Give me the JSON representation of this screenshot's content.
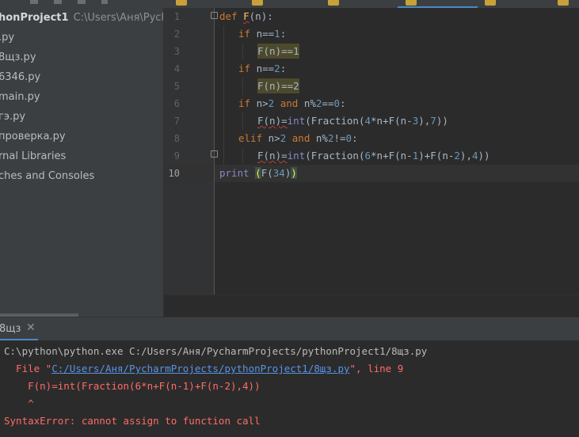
{
  "sidebar": {
    "project_name": "honProject1",
    "project_path": "C:\\Users\\Аня\\Pychar",
    "items": [
      {
        "label": ".py"
      },
      {
        "label": "8щз.py"
      },
      {
        "label": "6346.py"
      },
      {
        "label": "main.py"
      },
      {
        "label": "гэ.py"
      },
      {
        "label": "проверка.py"
      },
      {
        "label": "rnal Libraries"
      },
      {
        "label": "ches and Consoles"
      }
    ]
  },
  "editor": {
    "line_numbers": [
      "1",
      "2",
      "3",
      "4",
      "5",
      "6",
      "7",
      "8",
      "9",
      "10"
    ],
    "current_line": "10",
    "code": {
      "l1": {
        "kw": "def",
        "fn": "F",
        "rest": "(n):"
      },
      "l2": {
        "kw": "if",
        "a": "n==",
        "n": "1",
        "b": ":"
      },
      "l3": {
        "text": "F(n)==1"
      },
      "l4": {
        "kw": "if",
        "a": "n==",
        "n": "2",
        "b": ":"
      },
      "l5": {
        "text": "F(n)==2"
      },
      "l6": {
        "kw1": "if",
        "a": "n>",
        "n1": "2",
        "kw2": "and",
        "b": "n%",
        "n2": "2",
        "c": "==",
        "n3": "0",
        "d": ":"
      },
      "l7": {
        "a": "F(n)=",
        "bi": "int",
        "b": "(Fraction(",
        "n1": "4",
        "c": "*n+F(n-",
        "n2": "3",
        "d": "),",
        "n3": "7",
        "e": "))"
      },
      "l8": {
        "kw1": "elif",
        "a": "n>",
        "n1": "2",
        "kw2": "and",
        "b": "n%",
        "n2": "2",
        "c": "!=",
        "n3": "0",
        "d": ":"
      },
      "l9": {
        "a": "F(n)=",
        "bi": "int",
        "b": "(Fraction(",
        "n1": "6",
        "c": "*n+F(n-",
        "n2": "1",
        "d": ")+F(n-",
        "n3": "2",
        "e": "),",
        "n4": "4",
        "f": "))"
      },
      "l10": {
        "bi": "print",
        "sp": " ",
        "open": "(",
        "a": "F(",
        "n": "34",
        "b": ")",
        "close": ")"
      }
    }
  },
  "run": {
    "tab_label": "8щз",
    "close_glyph": "✕",
    "lines": {
      "cmd": "C:\\python\\python.exe C:/Users/Аня/PycharmProjects/pythonProject1/8щз.py",
      "file_prefix": "  File \"",
      "file_link": "C:/Users/Аня/PycharmProjects/pythonProject1/8щз.py",
      "file_suffix": "\", line 9",
      "code_line": "    F(n)=int(Fraction(6*n+F(n-1)+F(n-2),4))",
      "caret": "    ^",
      "error": "SyntaxError: cannot assign to function call"
    }
  },
  "colors": {
    "keyword": "#cc7832",
    "function": "#ffc66d",
    "number": "#6897bb",
    "builtin": "#8888c6",
    "error_text": "#ff6b68",
    "link": "#5894e8"
  }
}
